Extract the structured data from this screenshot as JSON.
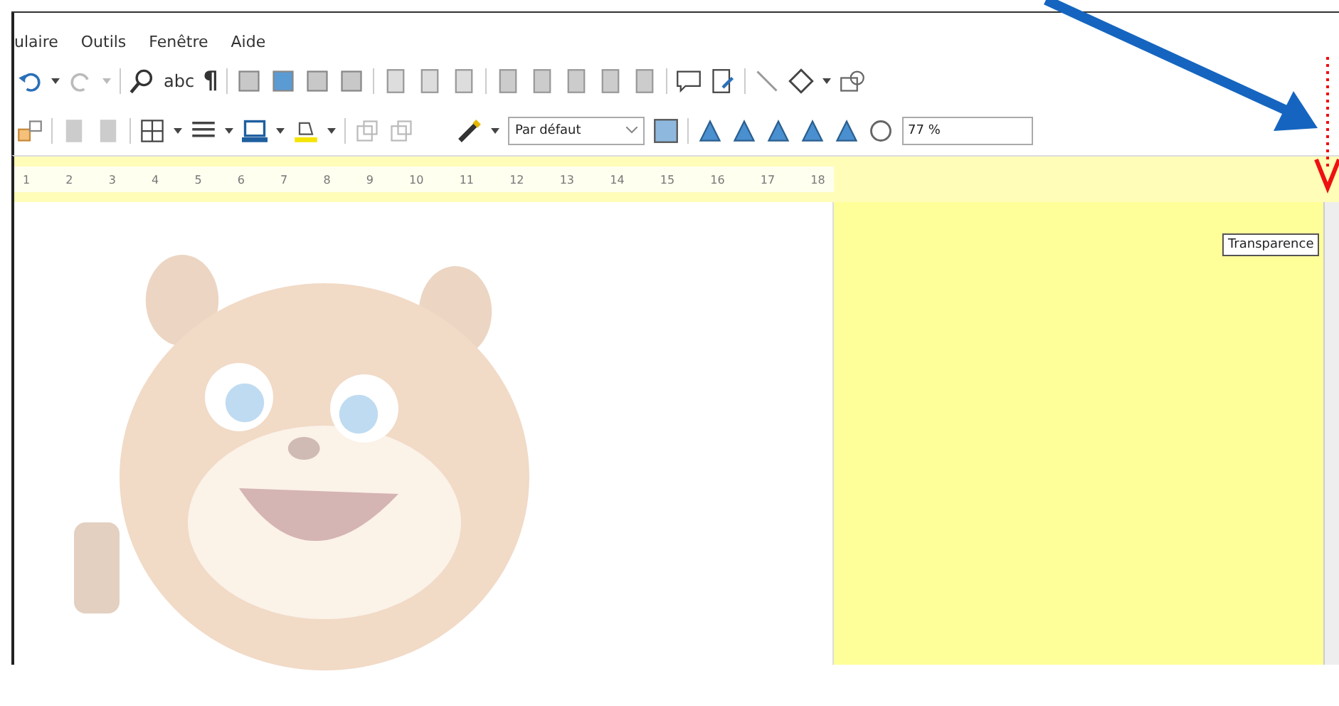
{
  "menu_bar": {
    "items": [
      "ulaire",
      "Outils",
      "Fenêtre",
      "Aide"
    ]
  },
  "standard_toolbar": {
    "spelling_glyph": "abc",
    "formatting_marks_glyph": "¶"
  },
  "image_toolbar": {
    "style_dropdown": {
      "value": "Par défaut"
    },
    "transparency_field": {
      "value": "77 %"
    }
  },
  "ruler": {
    "labels": [
      "1",
      "2",
      "3",
      "4",
      "5",
      "6",
      "7",
      "8",
      "9",
      "10",
      "11",
      "12",
      "13",
      "14",
      "15",
      "16",
      "17",
      "18"
    ]
  },
  "tooltip": {
    "text": "Transparence"
  }
}
